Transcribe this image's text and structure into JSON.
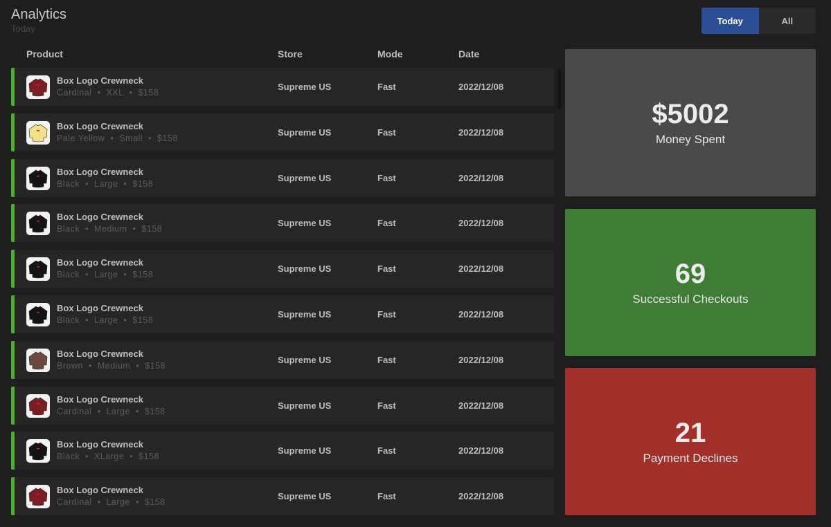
{
  "header": {
    "title": "Analytics",
    "subtitle": "Today"
  },
  "filter": {
    "options": [
      "Today",
      "All"
    ],
    "selected": "Today"
  },
  "table": {
    "columns": {
      "product": "Product",
      "store": "Store",
      "mode": "Mode",
      "date": "Date"
    },
    "rows": [
      {
        "name": "Box Logo Crewneck",
        "color": "Cardinal",
        "size": "XXL",
        "price": "$158",
        "store": "Supreme US",
        "mode": "Fast",
        "date": "2022/12/08",
        "swatch": "#7a1e22"
      },
      {
        "name": "Box Logo Crewneck",
        "color": "Pale Yellow",
        "size": "Small",
        "price": "$158",
        "store": "Supreme US",
        "mode": "Fast",
        "date": "2022/12/08",
        "swatch": "#f5e08a"
      },
      {
        "name": "Box Logo Crewneck",
        "color": "Black",
        "size": "Large",
        "price": "$158",
        "store": "Supreme US",
        "mode": "Fast",
        "date": "2022/12/08",
        "swatch": "#141414"
      },
      {
        "name": "Box Logo Crewneck",
        "color": "Black",
        "size": "Medium",
        "price": "$158",
        "store": "Supreme US",
        "mode": "Fast",
        "date": "2022/12/08",
        "swatch": "#141414"
      },
      {
        "name": "Box Logo Crewneck",
        "color": "Black",
        "size": "Large",
        "price": "$158",
        "store": "Supreme US",
        "mode": "Fast",
        "date": "2022/12/08",
        "swatch": "#141414"
      },
      {
        "name": "Box Logo Crewneck",
        "color": "Black",
        "size": "Large",
        "price": "$158",
        "store": "Supreme US",
        "mode": "Fast",
        "date": "2022/12/08",
        "swatch": "#141414"
      },
      {
        "name": "Box Logo Crewneck",
        "color": "Brown",
        "size": "Medium",
        "price": "$158",
        "store": "Supreme US",
        "mode": "Fast",
        "date": "2022/12/08",
        "swatch": "#6b4a3e"
      },
      {
        "name": "Box Logo Crewneck",
        "color": "Cardinal",
        "size": "Large",
        "price": "$158",
        "store": "Supreme US",
        "mode": "Fast",
        "date": "2022/12/08",
        "swatch": "#7a1e22"
      },
      {
        "name": "Box Logo Crewneck",
        "color": "Black",
        "size": "XLarge",
        "price": "$158",
        "store": "Supreme US",
        "mode": "Fast",
        "date": "2022/12/08",
        "swatch": "#141414"
      },
      {
        "name": "Box Logo Crewneck",
        "color": "Cardinal",
        "size": "Large",
        "price": "$158",
        "store": "Supreme US",
        "mode": "Fast",
        "date": "2022/12/08",
        "swatch": "#7a1e22"
      }
    ]
  },
  "stats": {
    "money": {
      "value": "$5002",
      "label": "Money Spent"
    },
    "success": {
      "value": "69",
      "label": "Successful Checkouts"
    },
    "declines": {
      "value": "21",
      "label": "Payment Declines"
    }
  },
  "colors": {
    "accent_blue": "#2a4d96",
    "row_accent_green": "#4caf2e",
    "card_gray": "#4a4a4a",
    "card_green": "#3e7d33",
    "card_red": "#a1302a"
  }
}
